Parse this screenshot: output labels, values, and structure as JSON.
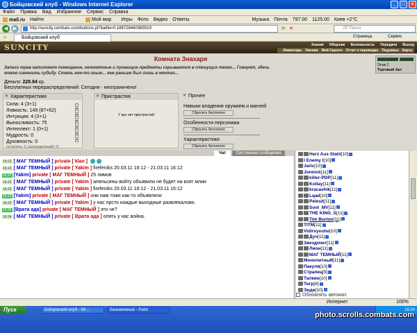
{
  "window": {
    "title": "Бойцовский клуб - Windows Internet Explorer"
  },
  "menu": [
    "Файл",
    "Правка",
    "Вид",
    "Избранное",
    "Сервис",
    "Справка"
  ],
  "links": [
    "mail.ru",
    "Найти",
    "Мой мир",
    "Игры",
    "Фото",
    "Видео",
    "Ответы",
    "Музыка",
    "Почта",
    "797.00",
    "1125.00",
    "Киев +2°C"
  ],
  "address": {
    "url": "http://suncity.combats.com/buttons.pl?battle=0.188728460365519",
    "search_placeholder": "ЛР Поиск"
  },
  "tabs": {
    "active": "Бойцовский клуб",
    "right": [
      "Страница",
      "Сервис"
    ]
  },
  "site": {
    "logo": "SUNCITY",
    "nav_top": [
      "Знания",
      "Общение",
      "Безопасность",
      "Передачи",
      "Выход"
    ],
    "nav_bottom": [
      "Инвентарь",
      "Умения",
      "Мой Скролл",
      "Отчет о переводах",
      "Подземье",
      "Карта"
    ],
    "rightbox": {
      "line1": "Этаж 2",
      "line2": "Торговый Зал"
    }
  },
  "room": {
    "title": "Комната Знахаря",
    "description": "Запахи трав наполняют помещение, непонятные и пугающие предметы скрываются в пляшущих тенях... Говорят, здесь можно изменить судьбу. Стать кем-то иным... кем раньше был лишь в мечтах...",
    "money_label": "Деньги:",
    "money_value": "228.84",
    "money_unit": "кр.",
    "redistrib": "Бесплатных перераспределений: Сегодня - неограничено!"
  },
  "characteristics": {
    "header": "Характеристики",
    "stats": [
      "Сила: 4 (3+1)",
      "Ловкость: 149 (87+62)",
      "Интуиция: 4 (3+1)",
      "Выносливость: 75",
      "Интеллект: 1 (0+1)",
      "Мудрость: 0",
      "Духовность: 0"
    ],
    "footer": "(осталось: 0, распределений): 0)"
  },
  "addictions": {
    "header": "Пристрастия",
    "empty": "У вас нет пристрастий"
  },
  "other": {
    "header": "Прочее",
    "sections": [
      {
        "title": "Навыки владения оружием и магией",
        "button": "Сбросить бесплатно"
      },
      {
        "title": "Особенности персонажа",
        "button": "Сбросить бесплатно"
      },
      {
        "title": "Характеристики",
        "button": "Сбросить бесплатно"
      }
    ]
  },
  "chat_tabs": {
    "chat": "Чат",
    "system": "Системные сообщения"
  },
  "chat": [
    {
      "time": "16:22",
      "to": "[ МАГ ТЕМНЫЙ ]",
      "private": "private [ klan ]",
      "text": ""
    },
    {
      "time": "16:22",
      "to": "[ МАГ ТЕМНЫЙ ]",
      "private": "private [ Yakim ]",
      "text": "firefeniks 20.03.11 16:12 - 21.03.11 16:12"
    },
    {
      "time": "16:22",
      "to": "[Yakim]",
      "private": "private [ МАГ ТЕМНЫЙ ]",
      "text": "25 лимов"
    },
    {
      "time": "16:23",
      "to": "[ МАГ ТЕМНЫЙ ]",
      "private": "private [ Yakim ]",
      "text": "апельсины войту объявили не будет на взят млин"
    },
    {
      "time": "16:23",
      "to": "[ МАГ ТЕМНЫЙ ]",
      "private": "private [ Yakim ]",
      "text": "firefeniks 20.03.11 16:12 - 21.03.11 16:12"
    },
    {
      "time": "16:23",
      "to": "[Yakim]",
      "private": "private [ МАГ ТЕМНЫЙ ]",
      "text": "они нам тоже как-то объявляли"
    },
    {
      "time": "16:23",
      "to": "[ МАГ ТЕМНЫЙ ]",
      "private": "private [ Yakim ]",
      "text": "у нас прсто каждые выходные развлекалово."
    },
    {
      "time": "16:24",
      "to": "[Врата ада]",
      "private": "private [ МАГ ТЕМНЫЙ ]",
      "text": "это че?"
    },
    {
      "time": "16:24",
      "to": "[ МАГ ТЕМНЫЙ ]",
      "private": "private [ Врата ада ]",
      "text": "опять у нас война."
    }
  ],
  "users": [
    {
      "name": "Herz Aus Stahl",
      "level": "[10]"
    },
    {
      "name": "I Enemy I",
      "level": "[10]"
    },
    {
      "name": "Jarlc",
      "level": "[10]"
    },
    {
      "name": "Jonnick",
      "level": "[11]"
    },
    {
      "name": "killer-PDP",
      "level": "[11]"
    },
    {
      "name": "Kollay",
      "level": "[11]"
    },
    {
      "name": "kracavhik",
      "level": "[11]"
    },
    {
      "name": "Lqad",
      "level": "[10]"
    },
    {
      "name": "Pelesit",
      "level": "[11]"
    },
    {
      "name": "Sool_MV",
      "level": "[11]"
    },
    {
      "name": "THE KING_S",
      "level": "[11]"
    },
    {
      "name": "Tim Burton",
      "level": "[11]"
    },
    {
      "name": "TITM",
      "level": "[11]"
    },
    {
      "name": "Vidirvyvuho",
      "level": "[10]"
    },
    {
      "name": "Дуч",
      "level": "[11]"
    },
    {
      "name": "Звездочет",
      "level": "[11]"
    },
    {
      "name": "Лион",
      "level": "[11]"
    },
    {
      "name": "МАГ ТЕМНЫЙ",
      "level": "[11]"
    },
    {
      "name": "Монолитный",
      "level": "[11]"
    },
    {
      "name": "Пакуля",
      "level": "[10]"
    },
    {
      "name": "Страпец",
      "level": "[9]"
    },
    {
      "name": "Талкин",
      "level": "[10]"
    },
    {
      "name": "Тигр",
      "level": "[8]"
    },
    {
      "name": "Энди",
      "level": "[10]"
    }
  ],
  "refresh_option": "Обновлять автомат.",
  "status": {
    "zone": "Интернет",
    "zoom": "100%"
  },
  "taskbar": {
    "start": "Пуск",
    "items": [
      "Бойцовский клуб - Wi...",
      "Безымянный - Paint"
    ],
    "time": "16:24"
  },
  "watermark": "photo.scrolls.combats.com"
}
